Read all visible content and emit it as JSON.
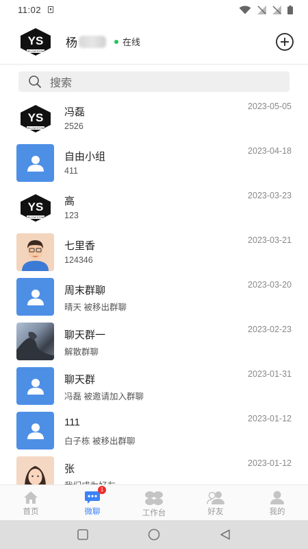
{
  "status": {
    "time": "11:02"
  },
  "header": {
    "name": "杨",
    "status_text": "在线"
  },
  "search": {
    "placeholder": "搜索"
  },
  "conversations": [
    {
      "title": "冯磊",
      "subtitle": "2526",
      "date": "2023-05-05",
      "avatar": "yellow-stone-logo"
    },
    {
      "title": "自由小组",
      "subtitle": "411",
      "date": "2023-04-18",
      "avatar": "group-icon"
    },
    {
      "title": "高",
      "subtitle": "123",
      "date": "2023-03-23",
      "avatar": "yellow-stone-logo"
    },
    {
      "title": "七里香",
      "subtitle": "124346",
      "date": "2023-03-21",
      "avatar": "cartoon-boy"
    },
    {
      "title": "周末群聊",
      "subtitle": "晴天  被移出群聊",
      "date": "2023-03-20",
      "avatar": "group-icon"
    },
    {
      "title": "聊天群一",
      "subtitle": "解散群聊",
      "date": "2023-02-23",
      "avatar": "photo"
    },
    {
      "title": "聊天群",
      "subtitle": "冯磊  被邀请加入群聊",
      "date": "2023-01-31",
      "avatar": "group-icon"
    },
    {
      "title": "111",
      "subtitle": "白子栋  被移出群聊",
      "date": "2023-01-12",
      "avatar": "group-icon"
    },
    {
      "title": "张",
      "subtitle": "我们成为好友",
      "date": "2023-01-12",
      "avatar": "cartoon-girl"
    }
  ],
  "tabs": [
    {
      "label": "首页",
      "icon": "home-icon"
    },
    {
      "label": "微聊",
      "icon": "chat-icon",
      "badge": "1",
      "active": true
    },
    {
      "label": "工作台",
      "icon": "workbench-icon"
    },
    {
      "label": "好友",
      "icon": "friends-icon"
    },
    {
      "label": "我的",
      "icon": "profile-icon"
    }
  ],
  "colors": {
    "accent": "#3b82f6",
    "online": "#22c55e",
    "badge": "#ef2b2b",
    "group_avatar": "#4e8fe6"
  }
}
